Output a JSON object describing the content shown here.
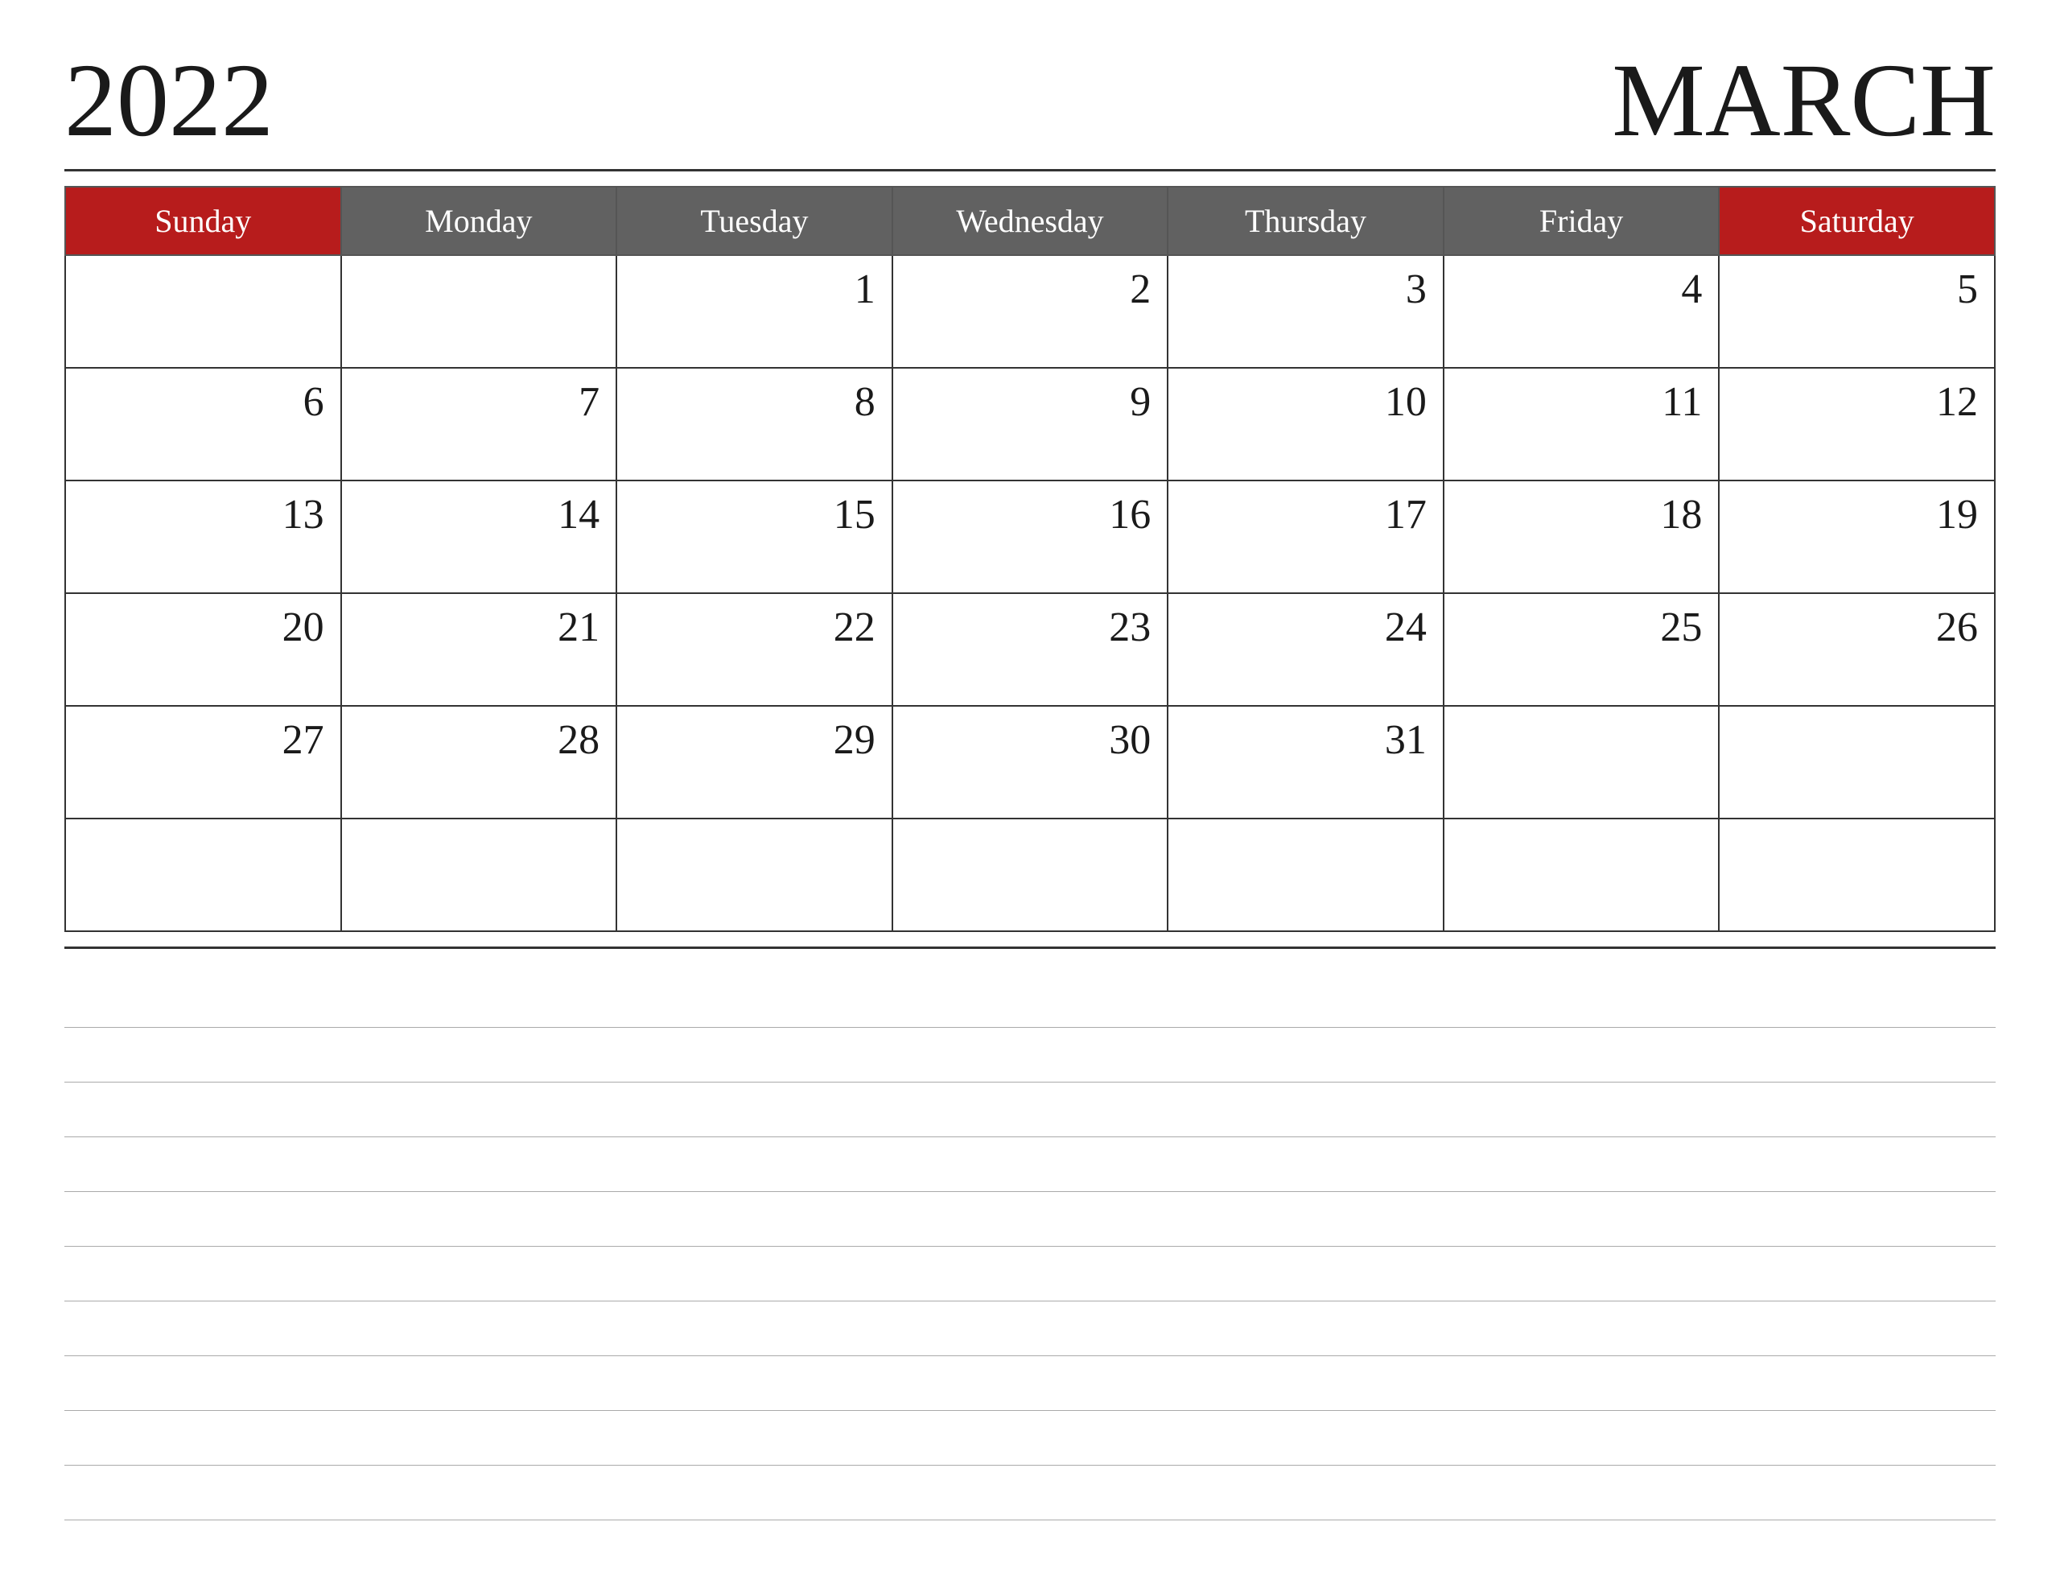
{
  "header": {
    "year": "2022",
    "month": "MARCH"
  },
  "days": {
    "sunday": "Sunday",
    "monday": "Monday",
    "tuesday": "Tuesday",
    "wednesday": "Wednesday",
    "thursday": "Thursday",
    "friday": "Friday",
    "saturday": "Saturday"
  },
  "weeks": [
    [
      "",
      "",
      "1",
      "2",
      "3",
      "4",
      "5"
    ],
    [
      "6",
      "7",
      "8",
      "9",
      "10",
      "11",
      "12"
    ],
    [
      "13",
      "14",
      "15",
      "16",
      "17",
      "18",
      "19"
    ],
    [
      "20",
      "21",
      "22",
      "23",
      "24",
      "25",
      "26"
    ],
    [
      "27",
      "28",
      "29",
      "30",
      "31",
      "",
      ""
    ],
    [
      "",
      "",
      "",
      "",
      "",
      "",
      ""
    ]
  ],
  "colors": {
    "sunday_bg": "#b71c1c",
    "saturday_bg": "#b71c1c",
    "weekday_bg": "#616161",
    "header_text": "#ffffff",
    "cell_text": "#1a1a1a",
    "border": "#333333"
  }
}
